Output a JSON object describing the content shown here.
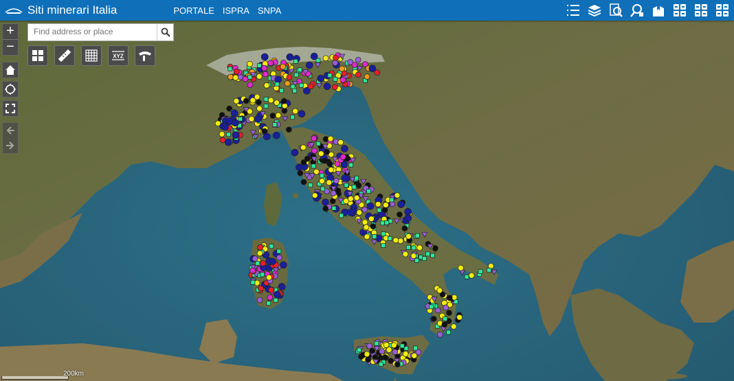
{
  "header": {
    "title": "Siti minerari Italia",
    "nav": [
      "PORTALE",
      "ISPRA",
      "SNPA"
    ],
    "bg_color": "#0f6fb8"
  },
  "toolbar": {
    "icons": [
      "legend-list-icon",
      "layers-icon",
      "query-icon",
      "search-query-icon",
      "bookmark-icon",
      "widget-grid-icon",
      "widget-grid-icon",
      "widget-grid-icon"
    ]
  },
  "search": {
    "placeholder": "Find address or place"
  },
  "map_controls": {
    "zoom_in": "+",
    "zoom_out": "−",
    "widget_tools": [
      "basemap-gallery-icon",
      "measure-icon",
      "grid-icon",
      "xyz-coordinates-icon",
      "print-icon"
    ],
    "xyz_label": "XYZ"
  },
  "scalebar": {
    "label": "200km"
  },
  "legend_colors": {
    "sea": "#2f6f86",
    "land": "#5d6a3a",
    "yellow": "#f5ec10",
    "green": "#2ee89a",
    "dark_blue": "#1a1f9a",
    "purple": "#9a5ed8",
    "black": "#111111",
    "red": "#e8202a",
    "magenta": "#e02ad0",
    "orange": "#f29a1a"
  }
}
